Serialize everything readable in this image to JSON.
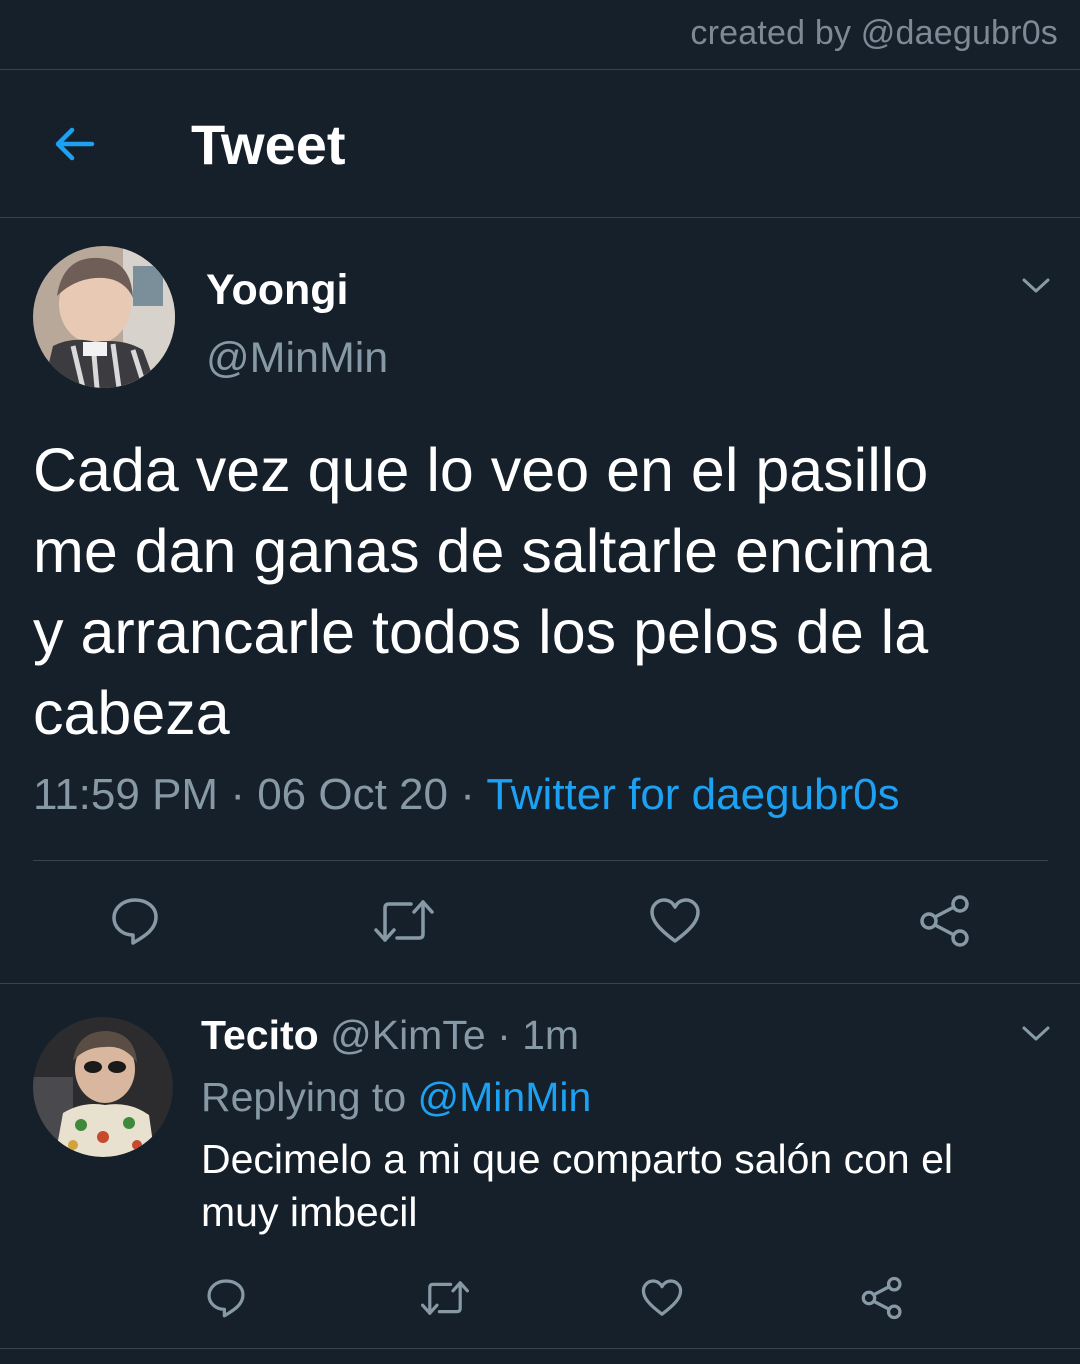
{
  "watermark": "created by @daegubr0s",
  "header": {
    "back_icon": "arrow-left-icon",
    "title": "Tweet"
  },
  "colors": {
    "background": "#15202b",
    "accent": "#1da1f2",
    "secondary_text": "#8899a6",
    "divider": "#38444d"
  },
  "tweet": {
    "author_name": "Yoongi",
    "author_handle": "@MinMin",
    "text_lines": [
      "Cada vez que lo veo en el pasillo",
      "me dan ganas de saltarle encima",
      "y arrancarle todos los pelos de la",
      "cabeza"
    ],
    "time": "11:59 PM",
    "date": "06 Oct 20",
    "separator": "·",
    "source": "Twitter for daegubr0s",
    "actions": [
      "reply-icon",
      "retweet-icon",
      "like-icon",
      "share-icon"
    ]
  },
  "reply": {
    "author_name": "Tecito",
    "author_handle": "@KimTe",
    "time_ago": "1m",
    "replying_label": "Replying to",
    "replying_to": "@MinMin",
    "text_lines": [
      "Decimelo a mi que comparto salón con el",
      "muy imbecil"
    ],
    "actions": [
      "reply-icon",
      "retweet-icon",
      "like-icon",
      "share-icon"
    ]
  }
}
